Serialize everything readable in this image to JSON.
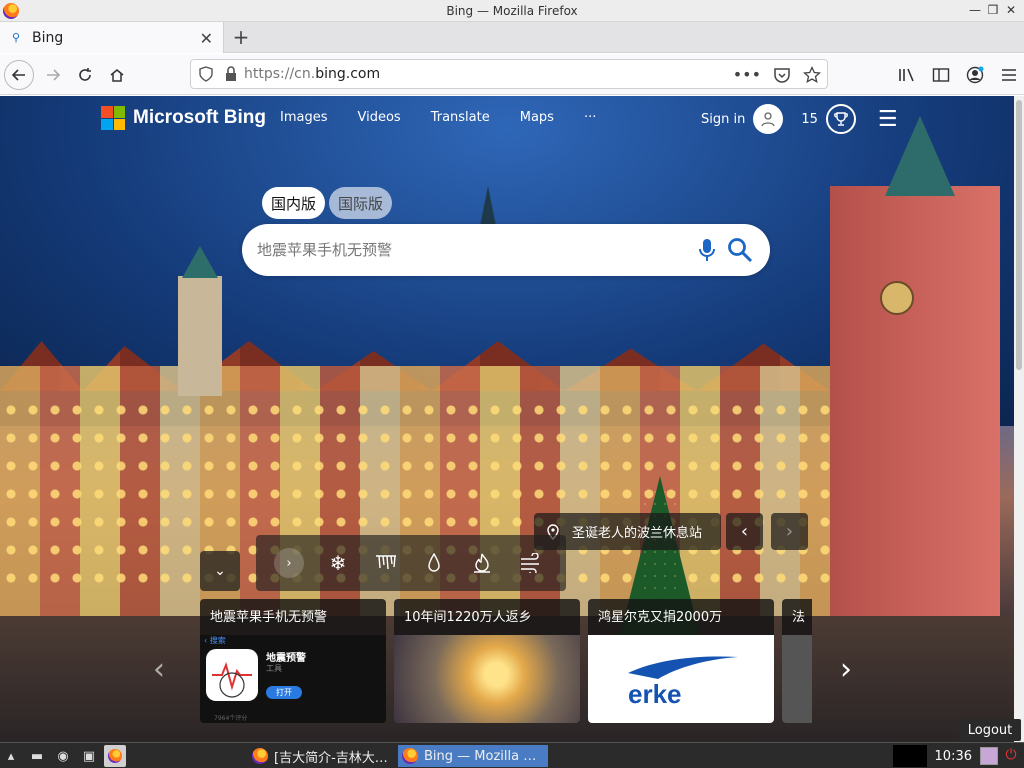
{
  "window": {
    "title": "Bing — Mozilla Firefox"
  },
  "tab": {
    "label": "Bing",
    "favicon": "bing-search-icon"
  },
  "url": {
    "prefix": "https://cn.",
    "domain": "bing.com"
  },
  "bing": {
    "brand": "Microsoft Bing",
    "logo_colors": [
      "#f25022",
      "#7fba00",
      "#00a4ef",
      "#ffb900"
    ],
    "nav": [
      "Images",
      "Videos",
      "Translate",
      "Maps",
      "···"
    ],
    "signin": "Sign in",
    "points": "15",
    "region_tabs": [
      "国内版",
      "国际版"
    ],
    "search_placeholder": "地震苹果手机无预警",
    "caption": "圣诞老人的波兰休息站",
    "cards": [
      {
        "title": "地震苹果手机无预警"
      },
      {
        "title": "10年间1220万人返乡"
      },
      {
        "title": "鸿星尔克又捐2000万"
      },
      {
        "title": "法"
      }
    ],
    "card1_app": {
      "back": "搜索",
      "name": "地震预警",
      "sub": "工具",
      "button": "打开",
      "rating": "7964个评分"
    },
    "card3_brand": "erke"
  },
  "logout": "Logout",
  "taskbar": {
    "tasks": [
      "[吉大简介-吉林大…",
      "Bing — Mozilla …"
    ],
    "time": "10:36"
  }
}
